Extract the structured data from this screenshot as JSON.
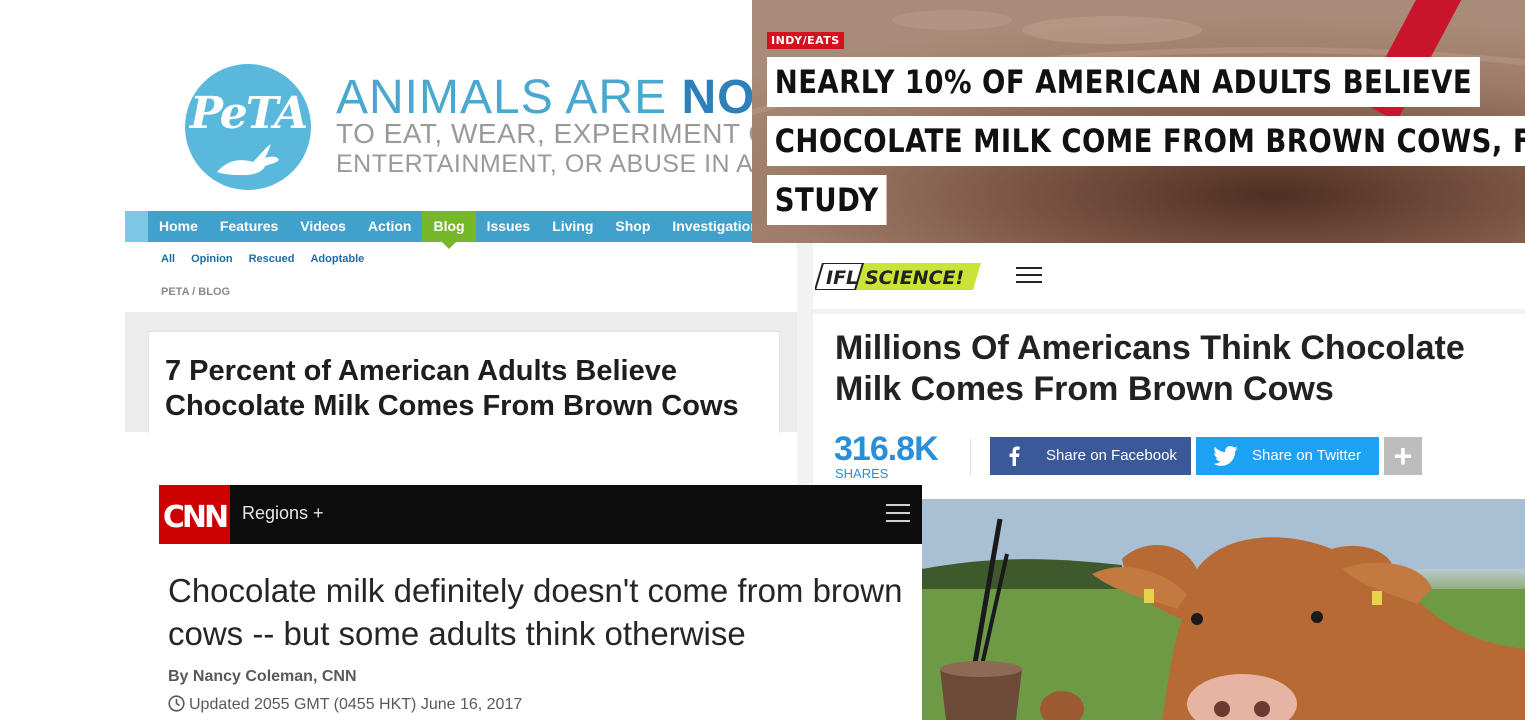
{
  "peta": {
    "logo_text": "PeTA",
    "tagline_line1_pre": "ANIMALS ARE ",
    "tagline_line1_bold": "NOT",
    "tagline_line2": "TO EAT, WEAR, EXPERIMENT O",
    "tagline_line3": "ENTERTAINMENT, OR ABUSE IN ANY",
    "nav": [
      "Home",
      "Features",
      "Videos",
      "Action",
      "Blog",
      "Issues",
      "Living",
      "Shop",
      "Investigations"
    ],
    "active_nav": "Blog",
    "subnav": [
      "All",
      "Opinion",
      "Rescued",
      "Adoptable"
    ],
    "breadcrumb": "PETA / BLOG",
    "headline": "7 Percent of American Adults Believe Chocolate Milk Comes From Brown Cows",
    "colors": {
      "brand_blue": "#5ab8dc",
      "nav_blue": "#3fa1cc",
      "active_green": "#76b82a"
    }
  },
  "independent": {
    "badge": "INDY/EATS",
    "headline_lines": [
      "NEARLY 10% OF AMERICAN ADULTS BELIEVE",
      "CHOCOLATE MILK COME FROM BROWN COWS, FINDS",
      "STUDY"
    ],
    "colors": {
      "badge_red": "#d6111e"
    }
  },
  "ifl": {
    "logo_text": "IFLSCIENCE!",
    "menu_icon": "hamburger-icon",
    "title": "Millions Of Americans Think Chocolate Milk Comes From Brown Cows",
    "share_count": "316.8K",
    "shares_label": "SHARES",
    "facebook_label": "Share on Facebook",
    "twitter_label": "Share on Twitter",
    "more_label": "+",
    "colors": {
      "facebook": "#3b5998",
      "twitter": "#1da1f2",
      "count_blue": "#2a8fd8"
    }
  },
  "cnn": {
    "logo_text": "CNN",
    "regions_label": "Regions +",
    "menu_icon": "hamburger-icon",
    "title": "Chocolate milk definitely doesn't come from brown cows -- but some adults think otherwise",
    "byline": "By Nancy Coleman, CNN",
    "updated": "Updated 2055 GMT (0455 HKT) June 16, 2017",
    "colors": {
      "logo_red": "#cc0000",
      "bar_black": "#0c0c0c"
    }
  },
  "photo": {
    "subject": "cow with chocolate milkshake and straws"
  }
}
